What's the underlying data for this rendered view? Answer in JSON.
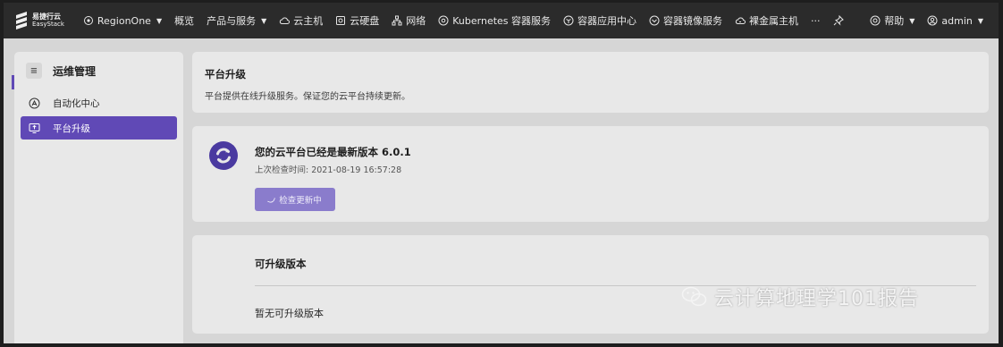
{
  "topbar": {
    "logo_cn": "易捷行云",
    "logo_en": "EasyStack",
    "region": "RegionOne",
    "nav": {
      "overview": "概览",
      "products": "产品与服务",
      "cloud_host": "云主机",
      "cloud_disk": "云硬盘",
      "network": "网络",
      "kubernetes": "Kubernetes 容器服务",
      "container_app": "容器应用中心",
      "container_image": "容器镜像服务",
      "bare_metal": "裸金属主机",
      "more": "···"
    },
    "help": "帮助",
    "user": "admin"
  },
  "sidebar": {
    "title": "运维管理",
    "items": [
      {
        "label": "自动化中心"
      },
      {
        "label": "平台升级"
      }
    ]
  },
  "header_card": {
    "title": "平台升级",
    "description": "平台提供在线升级服务。保证您的云平台持续更新。"
  },
  "version_card": {
    "title": "您的云平台已经是最新版本 6.0.1",
    "last_check": "上次检查时间: 2021-08-19 16:57:28",
    "button": "检查更新中"
  },
  "upgrade_card": {
    "title": "可升级版本",
    "empty": "暂无可升级版本"
  },
  "watermark": "云计算地理学101报告",
  "colors": {
    "accent": "#6049b6",
    "topbar": "#2b2b2b",
    "button": "#8a7ccc"
  }
}
